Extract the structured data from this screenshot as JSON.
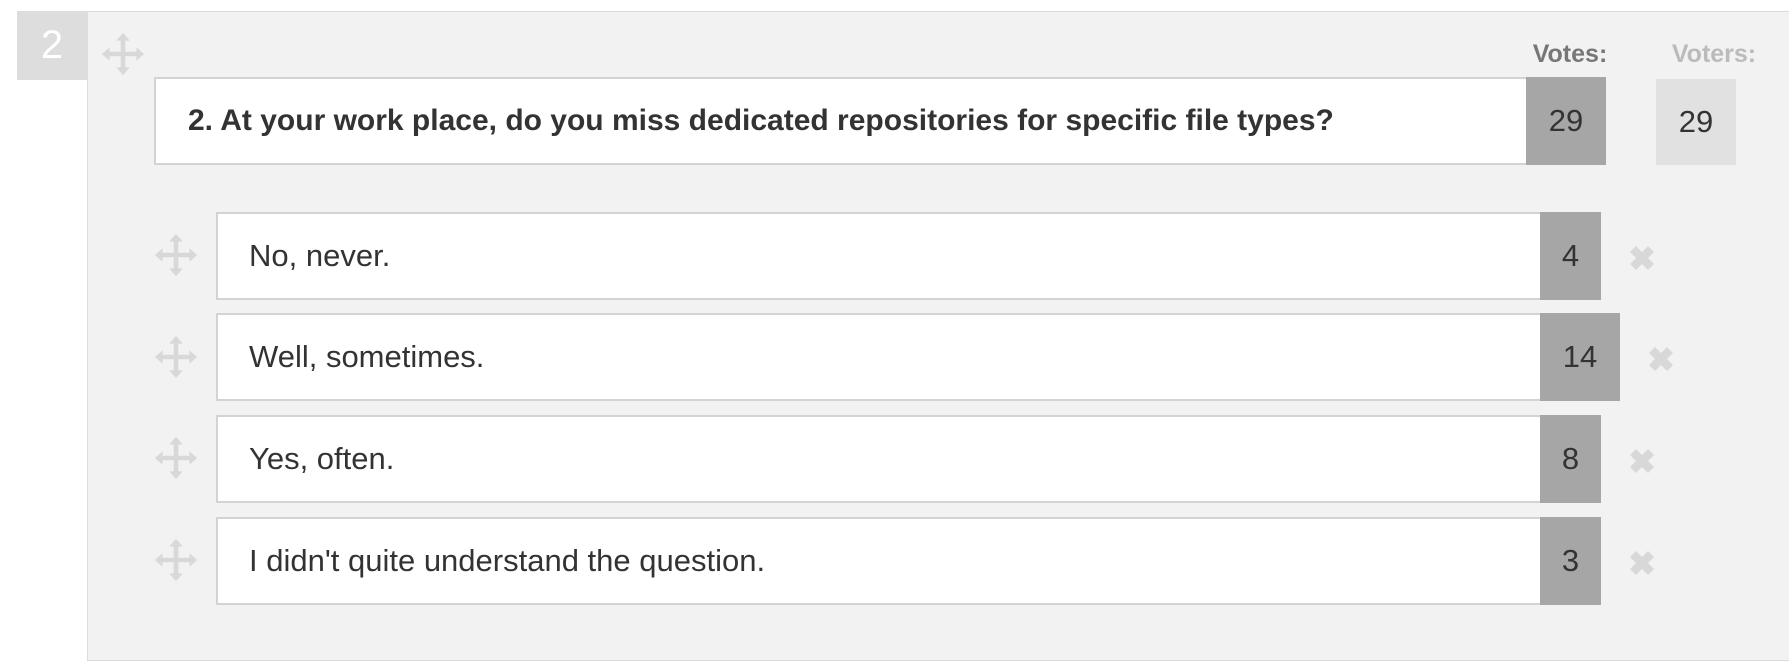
{
  "poll": {
    "number": "2",
    "headers": {
      "votes": "Votes:",
      "voters": "Voters:"
    },
    "question": {
      "text": "2. At your work place, do you miss dedicated repositories for specific file types?",
      "votes": "29",
      "voters": "29"
    },
    "answers": [
      {
        "text": "No, never.",
        "votes": "4"
      },
      {
        "text": "Well, sometimes.",
        "votes": "14"
      },
      {
        "text": "Yes, often.",
        "votes": "8"
      },
      {
        "text": "I didn't quite understand the question.",
        "votes": "3"
      }
    ]
  },
  "icons": {
    "drag": "move-arrows-icon",
    "remove": "close-x-icon"
  },
  "colors": {
    "panel_bg": "#f2f2f2",
    "number_badge": "#dddddd",
    "vote_box": "#a6a6a6",
    "voter_box": "#e1e1e1",
    "votes_header": "#777777",
    "voters_header": "#bbbbbb",
    "icon": "#d8d8d8"
  }
}
